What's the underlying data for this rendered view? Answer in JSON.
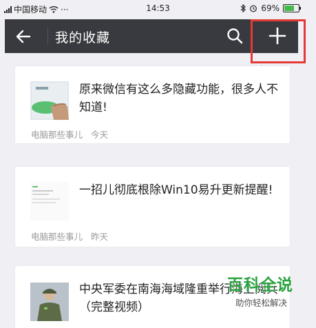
{
  "status_bar": {
    "carrier": "中国移动",
    "dots": "···",
    "time": "14:53",
    "battery": "69%"
  },
  "header": {
    "title": "我的收藏"
  },
  "favorites": [
    {
      "title": "原来微信有这么多隐藏功能，很多人不知道!",
      "source": "电脑那些事儿",
      "date": "今天"
    },
    {
      "title": "一招儿彻底根除Win10易升更新提醒!",
      "source": "电脑那些事儿",
      "date": "昨天"
    },
    {
      "title": "中央军委在南海海域隆重举行海上阅兵（完整视频）",
      "source": "",
      "date": ""
    }
  ],
  "watermark": {
    "name": "百科全说",
    "slogan": "助你轻松解决"
  },
  "colors": {
    "header_bg": "#393a3f",
    "page_bg": "#efeff4",
    "annotation_red": "#e53935",
    "watermark_green": "#2aa33f"
  }
}
